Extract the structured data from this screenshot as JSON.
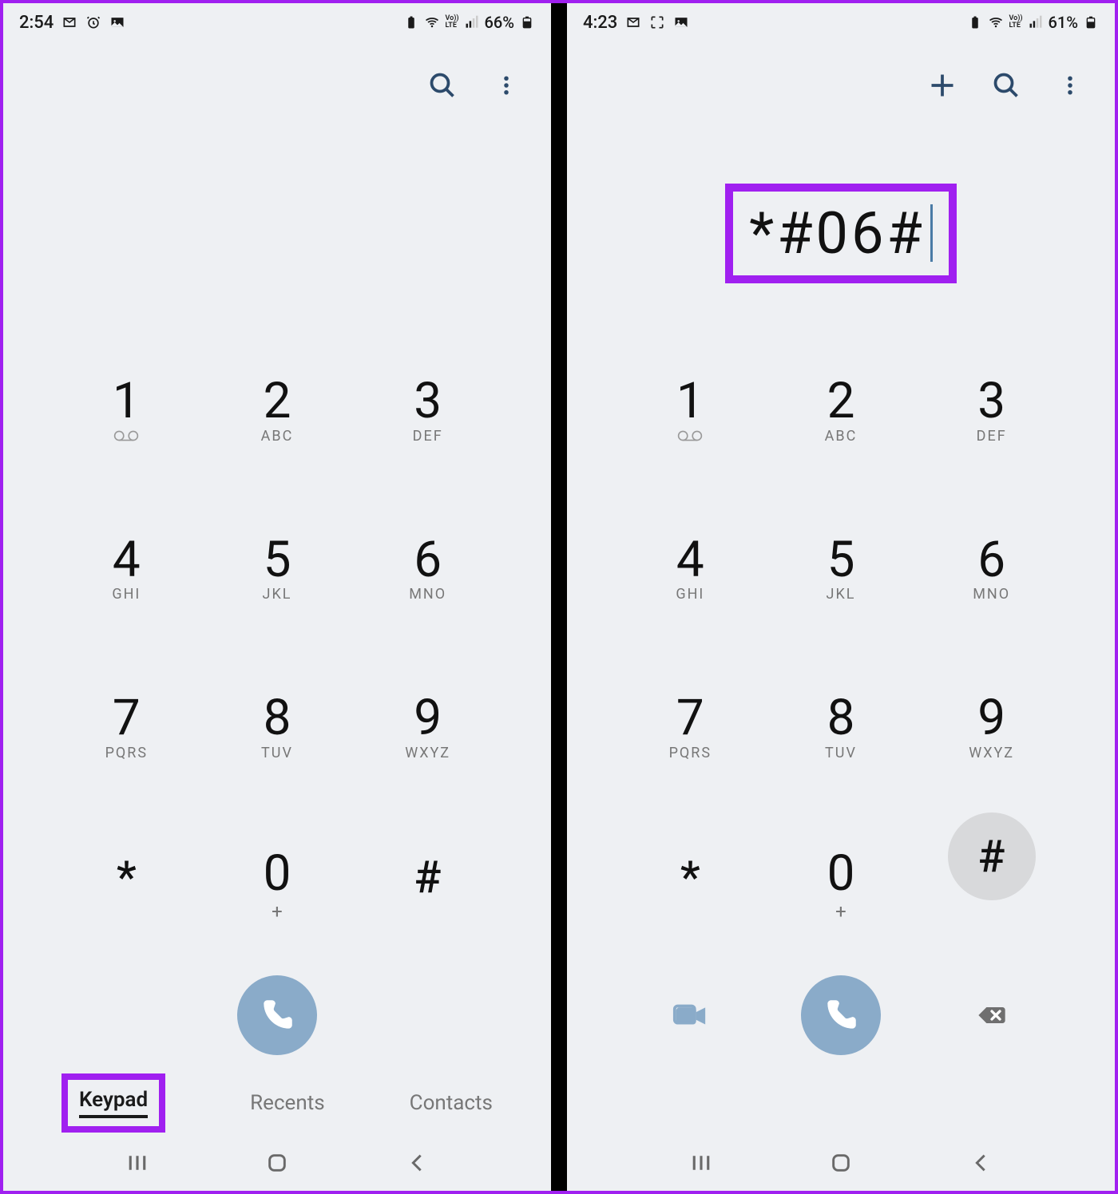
{
  "left": {
    "status": {
      "time": "2:54",
      "battery": "66%",
      "volte": "Vo))\nLTE"
    },
    "dialed": "",
    "keypad": [
      {
        "digit": "1",
        "sub": "voicemail"
      },
      {
        "digit": "2",
        "sub": "ABC"
      },
      {
        "digit": "3",
        "sub": "DEF"
      },
      {
        "digit": "4",
        "sub": "GHI"
      },
      {
        "digit": "5",
        "sub": "JKL"
      },
      {
        "digit": "6",
        "sub": "MNO"
      },
      {
        "digit": "7",
        "sub": "PQRS"
      },
      {
        "digit": "8",
        "sub": "TUV"
      },
      {
        "digit": "9",
        "sub": "WXYZ"
      },
      {
        "digit": "*",
        "sub": ""
      },
      {
        "digit": "0",
        "sub": "+"
      },
      {
        "digit": "#",
        "sub": ""
      }
    ],
    "tabs": {
      "keypad": "Keypad",
      "recents": "Recents",
      "contacts": "Contacts"
    },
    "show_tabs": true,
    "show_side_actions": false
  },
  "right": {
    "status": {
      "time": "4:23",
      "battery": "61%",
      "volte": "Vo))\nLTE"
    },
    "dialed": "*#06#",
    "keypad": [
      {
        "digit": "1",
        "sub": "voicemail"
      },
      {
        "digit": "2",
        "sub": "ABC"
      },
      {
        "digit": "3",
        "sub": "DEF"
      },
      {
        "digit": "4",
        "sub": "GHI"
      },
      {
        "digit": "5",
        "sub": "JKL"
      },
      {
        "digit": "6",
        "sub": "MNO"
      },
      {
        "digit": "7",
        "sub": "PQRS"
      },
      {
        "digit": "8",
        "sub": "TUV"
      },
      {
        "digit": "9",
        "sub": "WXYZ"
      },
      {
        "digit": "*",
        "sub": ""
      },
      {
        "digit": "0",
        "sub": "+"
      },
      {
        "digit": "#",
        "sub": "",
        "pressed": true
      }
    ],
    "show_tabs": false,
    "show_side_actions": true,
    "show_add": true
  },
  "icons": {
    "gmail": "M",
    "alarm": "alarm",
    "image": "image",
    "scan": "scan"
  },
  "highlight_color": "#a020f0",
  "accent": "#8aabc9"
}
